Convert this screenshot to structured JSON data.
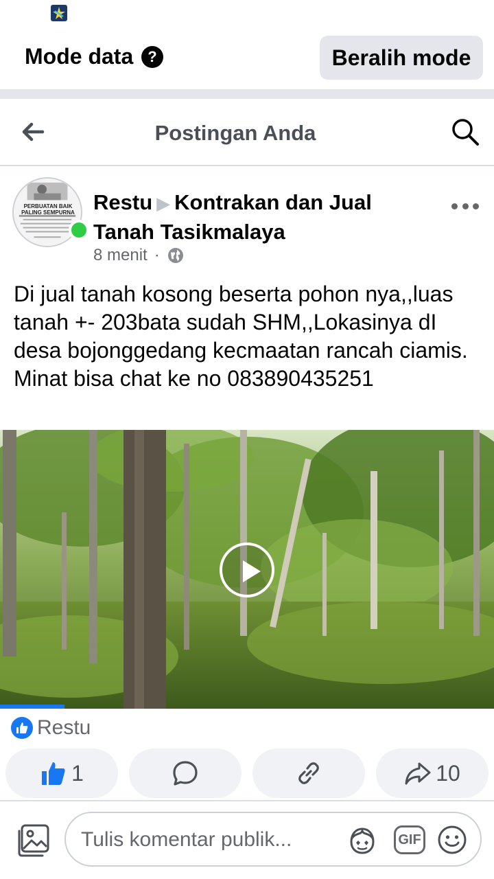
{
  "mode_bar": {
    "title": "Mode data",
    "help": "?",
    "switch_label": "Beralih mode"
  },
  "header": {
    "title": "Postingan Anda"
  },
  "post": {
    "author": "Restu",
    "group": "Kontrakan dan Jual Tanah Tasikmalaya",
    "time": "8 menit",
    "avatar_caption": "PERBUATAN BAIK PALING SEMPURNA",
    "text": "Di jual tanah kosong beserta pohon nya,,luas tanah +- 203bata sudah SHM,,Lokasinya dI desa bojonggedang kecmaatan rancah ciamis.  Minat bisa chat ke no 083890435251",
    "video_progress_percent": 13
  },
  "reactions": {
    "reactor": "Restu"
  },
  "actions": {
    "like_count": "1",
    "share_count": "10"
  },
  "composer": {
    "placeholder": "Tulis komentar publik..."
  },
  "colors": {
    "accent": "#1877f2",
    "online": "#31cc46",
    "muted": "#65676b",
    "button_bg": "#f0f2f5"
  }
}
